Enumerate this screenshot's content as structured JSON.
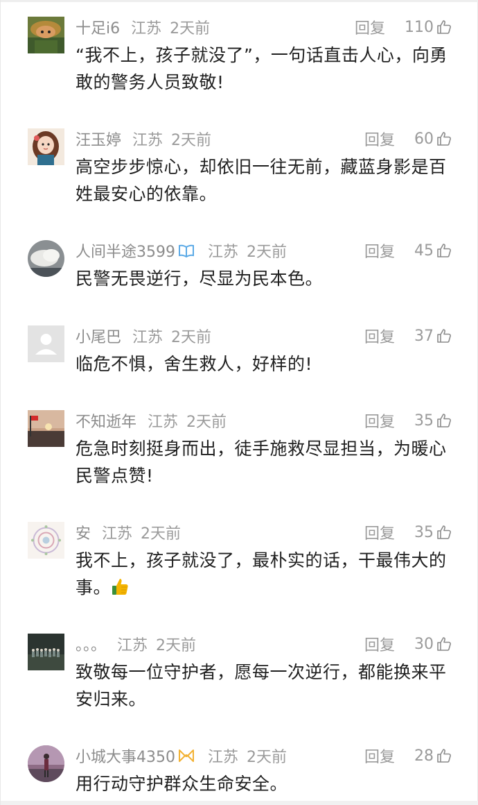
{
  "comments": [
    {
      "username": "十足i6",
      "location": "江苏",
      "time": "2天前",
      "reply_label": "回复",
      "likes": "110",
      "text": "“我不上，孩子就没了”，一句话直击人心，向勇敢的警务人员致敬!",
      "avatar_icon": "avatar-cartoon-helmet",
      "badge": null
    },
    {
      "username": "汪玉婷",
      "location": "江苏",
      "time": "2天前",
      "reply_label": "回复",
      "likes": "60",
      "text": "高空步步惊心，却依旧一往无前，藏蓝身影是百姓最安心的依靠。",
      "avatar_icon": "avatar-cartoon-girl",
      "badge": null
    },
    {
      "username": "人间半途3599",
      "location": "江苏",
      "time": "2天前",
      "reply_label": "回复",
      "likes": "45",
      "text": "民警无畏逆行，尽显为民本色。",
      "avatar_icon": "avatar-cloud-sky",
      "badge": "blue-book-badge-icon"
    },
    {
      "username": "小尾巴",
      "location": "江苏",
      "time": "2天前",
      "reply_label": "回复",
      "likes": "37",
      "text": "临危不惧，舍生救人，好样的!",
      "avatar_icon": "avatar-default-placeholder",
      "badge": null
    },
    {
      "username": "不知逝年",
      "location": "江苏",
      "time": "2天前",
      "reply_label": "回复",
      "likes": "35",
      "text": "危急时刻挺身而出，徒手施救尽显担当，为暖心民警点赞!",
      "avatar_icon": "avatar-sunset-flag",
      "badge": null
    },
    {
      "username": "安",
      "location": "江苏",
      "time": "2天前",
      "reply_label": "回复",
      "likes": "35",
      "text": "我不上，孩子就没了，最朴实的话，干最伟大的事。",
      "avatar_icon": "avatar-mandala-pattern",
      "badge": null,
      "trailing_emoji": "thumbs-up-emoji-icon"
    },
    {
      "username": "。。。",
      "location": "江苏",
      "time": "2天前",
      "reply_label": "回复",
      "likes": "30",
      "text": "致敬每一位守护者，愿每一次逆行，都能换来平安归来。",
      "avatar_icon": "avatar-group-photo",
      "badge": null
    },
    {
      "username": "小城大事4350",
      "location": "江苏",
      "time": "2天前",
      "reply_label": "回复",
      "likes": "28",
      "text": "用行动守护群众生命安全。",
      "avatar_icon": "avatar-person-outdoor",
      "badge": "gold-ribbon-badge-icon"
    }
  ],
  "colors": {
    "meta_gray": "#9a9a9a",
    "text_dark": "#1f1f1f",
    "blue_badge": "#5aa9e6",
    "gold_badge": "#f2b233"
  }
}
